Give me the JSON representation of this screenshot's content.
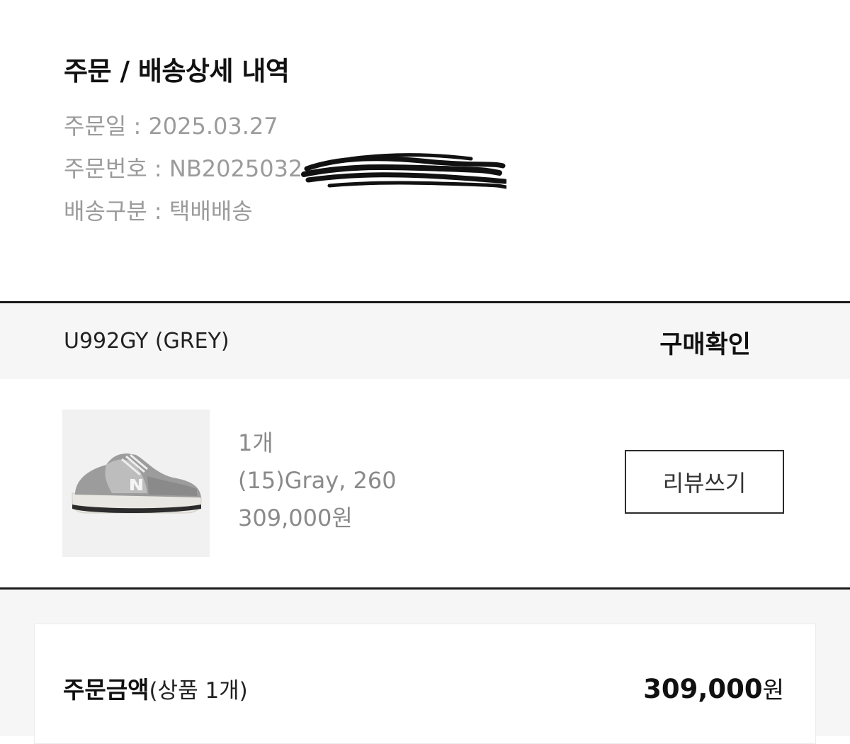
{
  "header": {
    "title": "주문 / 배송상세 내역",
    "order_date_label": "주문일 : 2025.03.27",
    "order_no_label": "주문번호 : NB2025032",
    "shipping_type_label": "배송구분 : 택배배송"
  },
  "item": {
    "name": "U992GY (GREY)",
    "status": "구매확인",
    "thumbnail_icon": "sneaker-image",
    "quantity": "1개",
    "option": "(15)Gray, 260",
    "price": "309,000원",
    "review_button": "리뷰쓰기"
  },
  "summary": {
    "label": "주문금액",
    "label_detail": "(상품 1개)",
    "amount": "309,000",
    "currency": "원"
  }
}
